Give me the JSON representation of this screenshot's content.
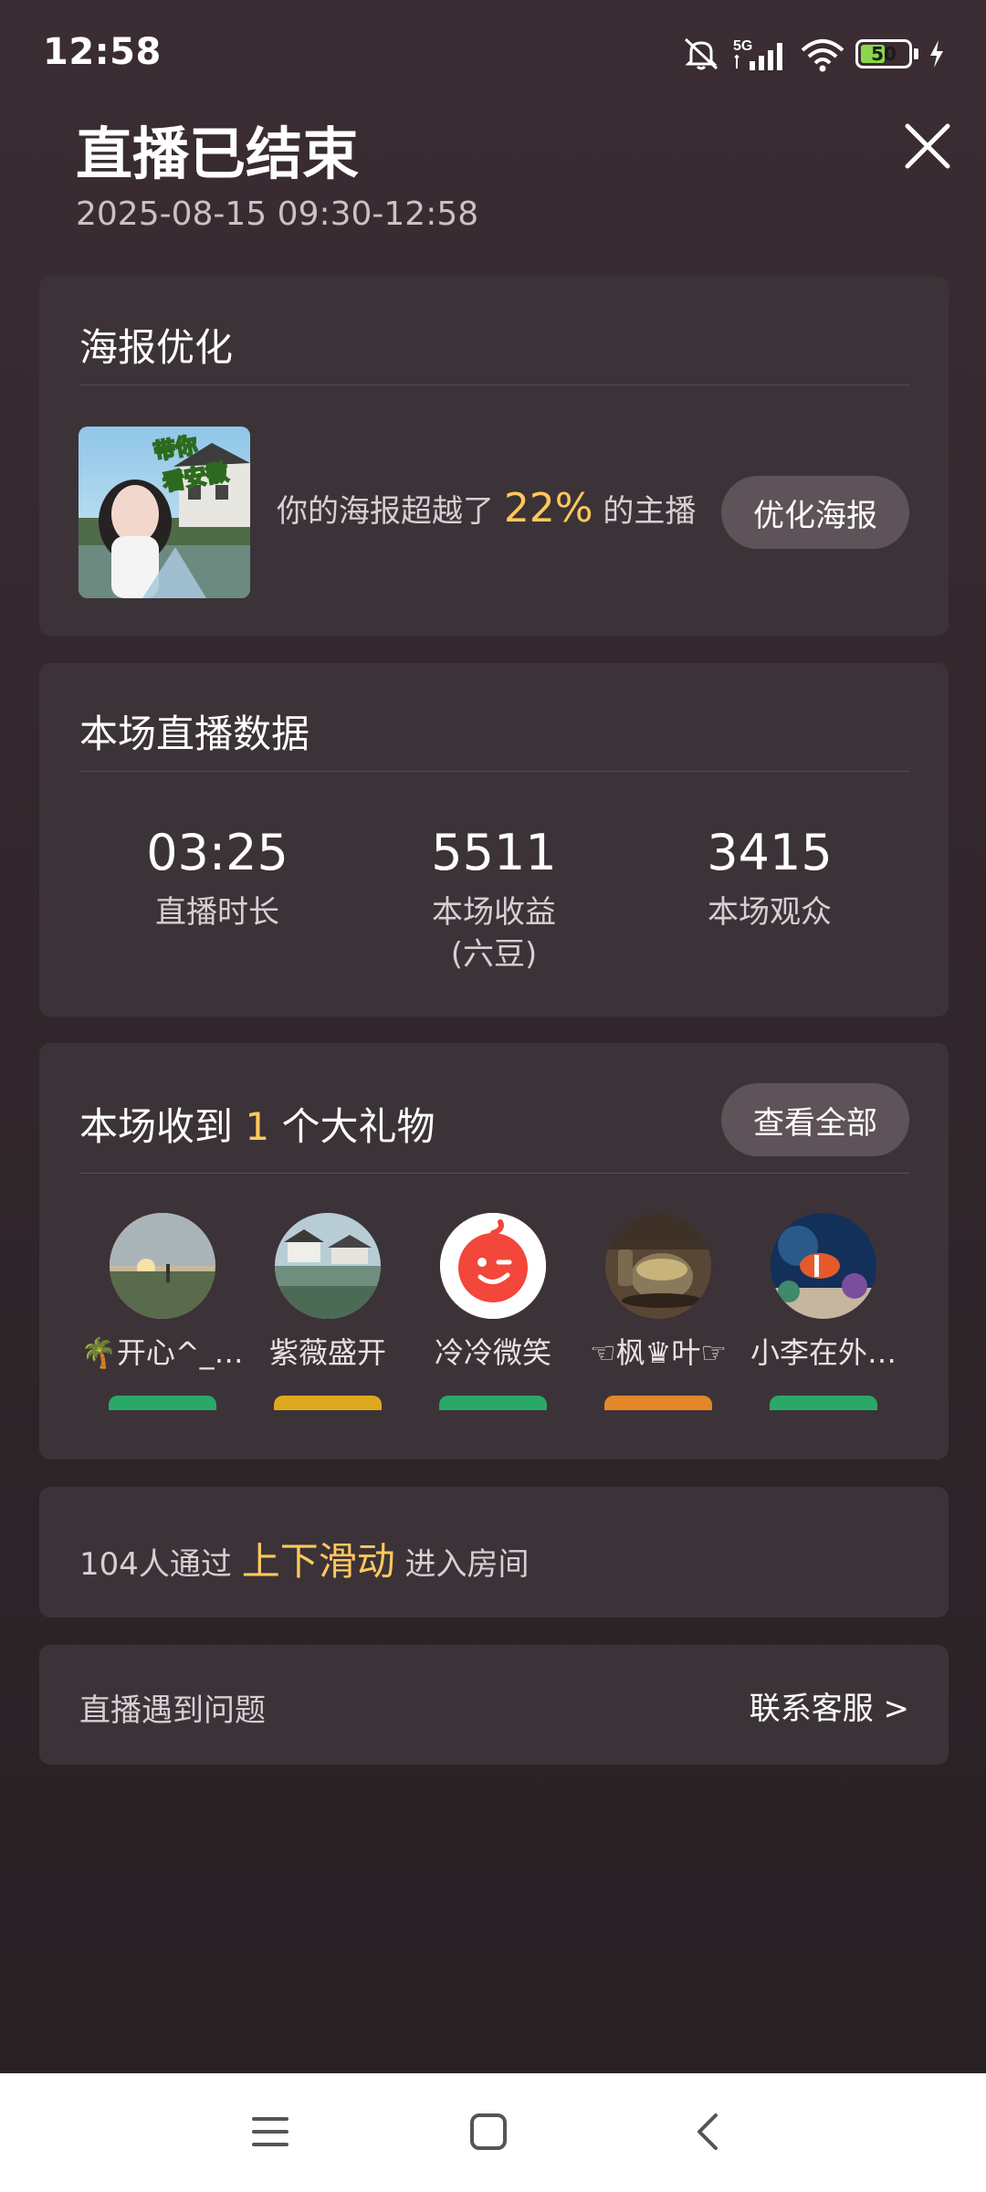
{
  "status_bar": {
    "time": "12:58",
    "network": "5G",
    "battery": "50",
    "battery_level": 0.5,
    "icons": [
      "mute-icon",
      "signal-icon",
      "wifi-icon",
      "battery-icon",
      "charging-icon"
    ]
  },
  "header": {
    "title": "直播已结束",
    "time_range": "2025-08-15 09:30-12:58",
    "close_icon": "close-icon"
  },
  "poster": {
    "title": "海报优化",
    "text_before": "你的海报超越了",
    "percent": "22%",
    "text_after": "的主播",
    "button": "优化海报",
    "thumb_caption_1": "带你",
    "thumb_caption_2": "看安徽"
  },
  "stats": {
    "title": "本场直播数据",
    "items": [
      {
        "value": "03:25",
        "label": "直播时长",
        "sub": ""
      },
      {
        "value": "5511",
        "label": "本场收益",
        "sub": "(六豆)"
      },
      {
        "value": "3415",
        "label": "本场观众",
        "sub": ""
      }
    ]
  },
  "gifts": {
    "title_before": "本场收到",
    "count": "1",
    "title_after": "个大礼物",
    "button": "查看全部",
    "users": [
      {
        "name": "🌴开心^_^…",
        "badge_color": "#2aa86a"
      },
      {
        "name": "紫薇盛开",
        "badge_color": "#e0a81e"
      },
      {
        "name": "冷冷微笑",
        "badge_color": "#2aa86a"
      },
      {
        "name": "☜枫♛叶☞",
        "badge_color": "#e4862a"
      },
      {
        "name": "小李在外…",
        "badge_color": "#2aa86a"
      }
    ]
  },
  "swipe": {
    "prefix": "104人通过",
    "highlight": "上下滑动",
    "suffix": "进入房间"
  },
  "support": {
    "label": "直播遇到问题",
    "link": "联系客服 >"
  },
  "nav": {
    "icons": [
      "menu-icon",
      "home-icon",
      "back-icon"
    ]
  },
  "colors": {
    "accent": "#ffc85c",
    "card_bg": "#3c3338",
    "button_bg": "#5e5359"
  }
}
